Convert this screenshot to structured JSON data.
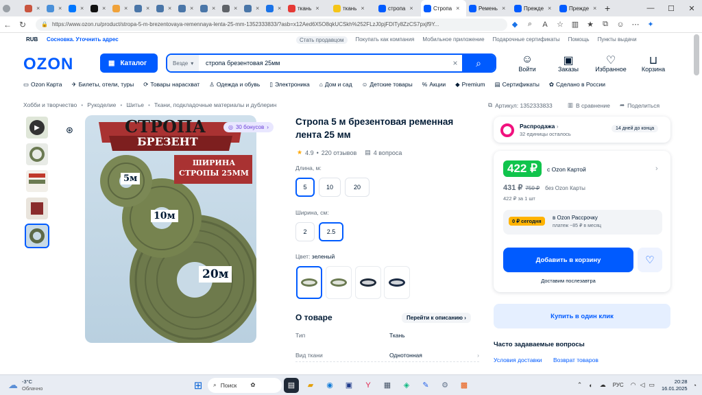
{
  "browser": {
    "tabs": [
      {
        "label": "",
        "color": "#c9553f",
        "kind": "small"
      },
      {
        "label": "",
        "color": "#4a90d9",
        "kind": "small"
      },
      {
        "label": "",
        "color": "#0077ff",
        "kind": "small"
      },
      {
        "label": "",
        "color": "#111111",
        "kind": "small"
      },
      {
        "label": "",
        "color": "#f0a23a",
        "kind": "small"
      },
      {
        "label": "",
        "color": "#4a76a8",
        "kind": "small"
      },
      {
        "label": "",
        "color": "#4a76a8",
        "kind": "small"
      },
      {
        "label": "",
        "color": "#4a76a8",
        "kind": "small"
      },
      {
        "label": "",
        "color": "#4a76a8",
        "kind": "small"
      },
      {
        "label": "",
        "color": "#5f6368",
        "kind": "small"
      },
      {
        "label": "",
        "color": "#4a76a8",
        "kind": "small"
      },
      {
        "label": "",
        "color": "#1a73e8",
        "kind": "small"
      },
      {
        "label": "ткань",
        "color": "#e53935",
        "kind": "mid"
      },
      {
        "label": "ткань",
        "color": "#f5c518",
        "kind": "mid"
      },
      {
        "label": "стропа",
        "color": "#005bff",
        "kind": "mid"
      },
      {
        "label": "Стропа",
        "color": "#005bff",
        "kind": "mid",
        "active": true
      },
      {
        "label": "Ремень",
        "color": "#005bff",
        "kind": "mid"
      },
      {
        "label": "Прежде",
        "color": "#005bff",
        "kind": "mid"
      },
      {
        "label": "Прежде",
        "color": "#005bff",
        "kind": "mid"
      }
    ],
    "url": "https://www.ozon.ru/product/stropa-5-m-brezentovaya-remennaya-lenta-25-mm-1352333833/?asb=x12Aed6X5O8qkUCSkh%252FLzJ0pjFDITy8ZzCS7pxjf9Y..."
  },
  "header": {
    "currency": "RUB",
    "location": "Сосновка. Уточнить адрес",
    "top_links": [
      "Стать продавцом",
      "Покупать как компания",
      "Мобильное приложение",
      "Подарочные сертификаты",
      "Помощь",
      "Пункты выдачи"
    ],
    "logo": "OZON",
    "catalog": "Каталог",
    "search_scope": "Везде",
    "search_value": "стропа брезентовая 25мм",
    "icons": [
      {
        "label": "Войти",
        "glyph": "☺"
      },
      {
        "label": "Заказы",
        "glyph": "▣"
      },
      {
        "label": "Избранное",
        "glyph": "♡"
      },
      {
        "label": "Корзина",
        "glyph": "⊔"
      }
    ]
  },
  "menu": [
    "Ozon Карта",
    "Билеты, отели, туры",
    "Товары нарасхват",
    "Одежда и обувь",
    "Электроника",
    "Дом и сад",
    "Детские товары",
    "Акции",
    "Premium",
    "Сертификаты",
    "Сделано в России"
  ],
  "breadcrumbs": [
    "Хобби и творчество",
    "Рукоделие",
    "Шитье",
    "Ткани, подкладочные материалы и дублерин"
  ],
  "meta": {
    "article": "Артикул: 1352333833",
    "compare": "В сравнение",
    "share": "Поделиться"
  },
  "gallery": {
    "bonus": "30 бонусов",
    "img_title1": "СТРОПА",
    "img_title2": "БРЕЗЕНТ",
    "img_width": "ШИРИНА СТРОПЫ 25ММ",
    "roll1": "5м",
    "roll2": "10м",
    "roll3": "20м"
  },
  "product": {
    "title": "Стропа 5 м брезентовая ременная лента 25 мм",
    "rating": "4.9",
    "reviews": "220 отзывов",
    "questions": "4 вопроса",
    "length_label": "Длина, м:",
    "lengths": [
      "5",
      "10",
      "20"
    ],
    "width_label": "Ширина, см:",
    "widths": [
      "2",
      "2.5"
    ],
    "color_label": "Цвет:",
    "color_value": "зеленый",
    "swatch_colors": [
      "#6b7a52",
      "#6b7a52",
      "#1e2a3a",
      "#1b2b44"
    ],
    "about_title": "О товаре",
    "about_link": "Перейти к описанию",
    "specs": [
      {
        "k": "Тип",
        "v": "Ткань"
      },
      {
        "k": "Вид ткани",
        "v": "Однотонная"
      }
    ]
  },
  "buy": {
    "sale_title": "Распродажа",
    "sale_sub": "32 единицы осталось",
    "sale_days": "14 дней до конца",
    "price_card": "422 ₽",
    "price_card_note": "с Ozon Картой",
    "price": "431 ₽",
    "price_old": "750 ₽",
    "price_note": "без Ozon Карты",
    "per_unit": "422 ₽ за 1 шт",
    "installment_badge": "0 ₽ сегодня",
    "installment_title": "в Ozon Рассрочку",
    "installment_sub": "платеж ~85 ₽ в месяц",
    "add_to_cart": "Добавить в корзину",
    "delivery": "Доставим послезавтра",
    "one_click": "Купить в один клик",
    "faq_title": "Часто задаваемые вопросы",
    "faq_links": [
      "Условия доставки",
      "Возврат товаров"
    ]
  },
  "taskbar": {
    "weather_temp": "-3°C",
    "weather_desc": "Облачно",
    "search": "Поиск",
    "lang": "РУС",
    "time": "20:28",
    "date": "16.01.2025"
  }
}
